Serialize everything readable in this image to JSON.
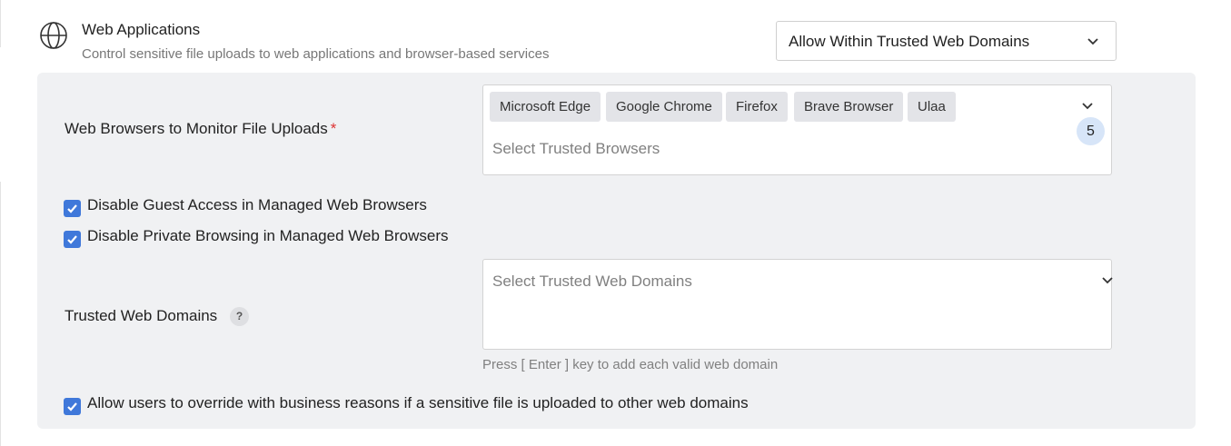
{
  "section": {
    "title": "Web Applications",
    "description": "Control sensitive file uploads to web applications and browser-based services",
    "icon": "globe-icon",
    "mode_value": "Allow Within Trusted Web Domains"
  },
  "browsers": {
    "label": "Web Browsers to Monitor File Uploads",
    "required_mark": "*",
    "chips": [
      "Microsoft Edge",
      "Google Chrome",
      "Firefox",
      "Brave Browser",
      "Ulaa"
    ],
    "placeholder": "Select Trusted Browsers",
    "count": "5"
  },
  "checks": {
    "guest": "Disable Guest Access in Managed Web Browsers",
    "private": "Disable Private Browsing in Managed Web Browsers",
    "override": "Allow users to override with business reasons if a sensitive file is uploaded to other web domains"
  },
  "domains": {
    "label": "Trusted Web Domains",
    "help": "?",
    "placeholder": "Select Trusted Web Domains",
    "hint": "Press [ Enter ] key to add each valid web domain"
  },
  "colors": {
    "accent": "#3f78da",
    "panel_bg": "#f0f1f3",
    "required": "#dd3333"
  }
}
